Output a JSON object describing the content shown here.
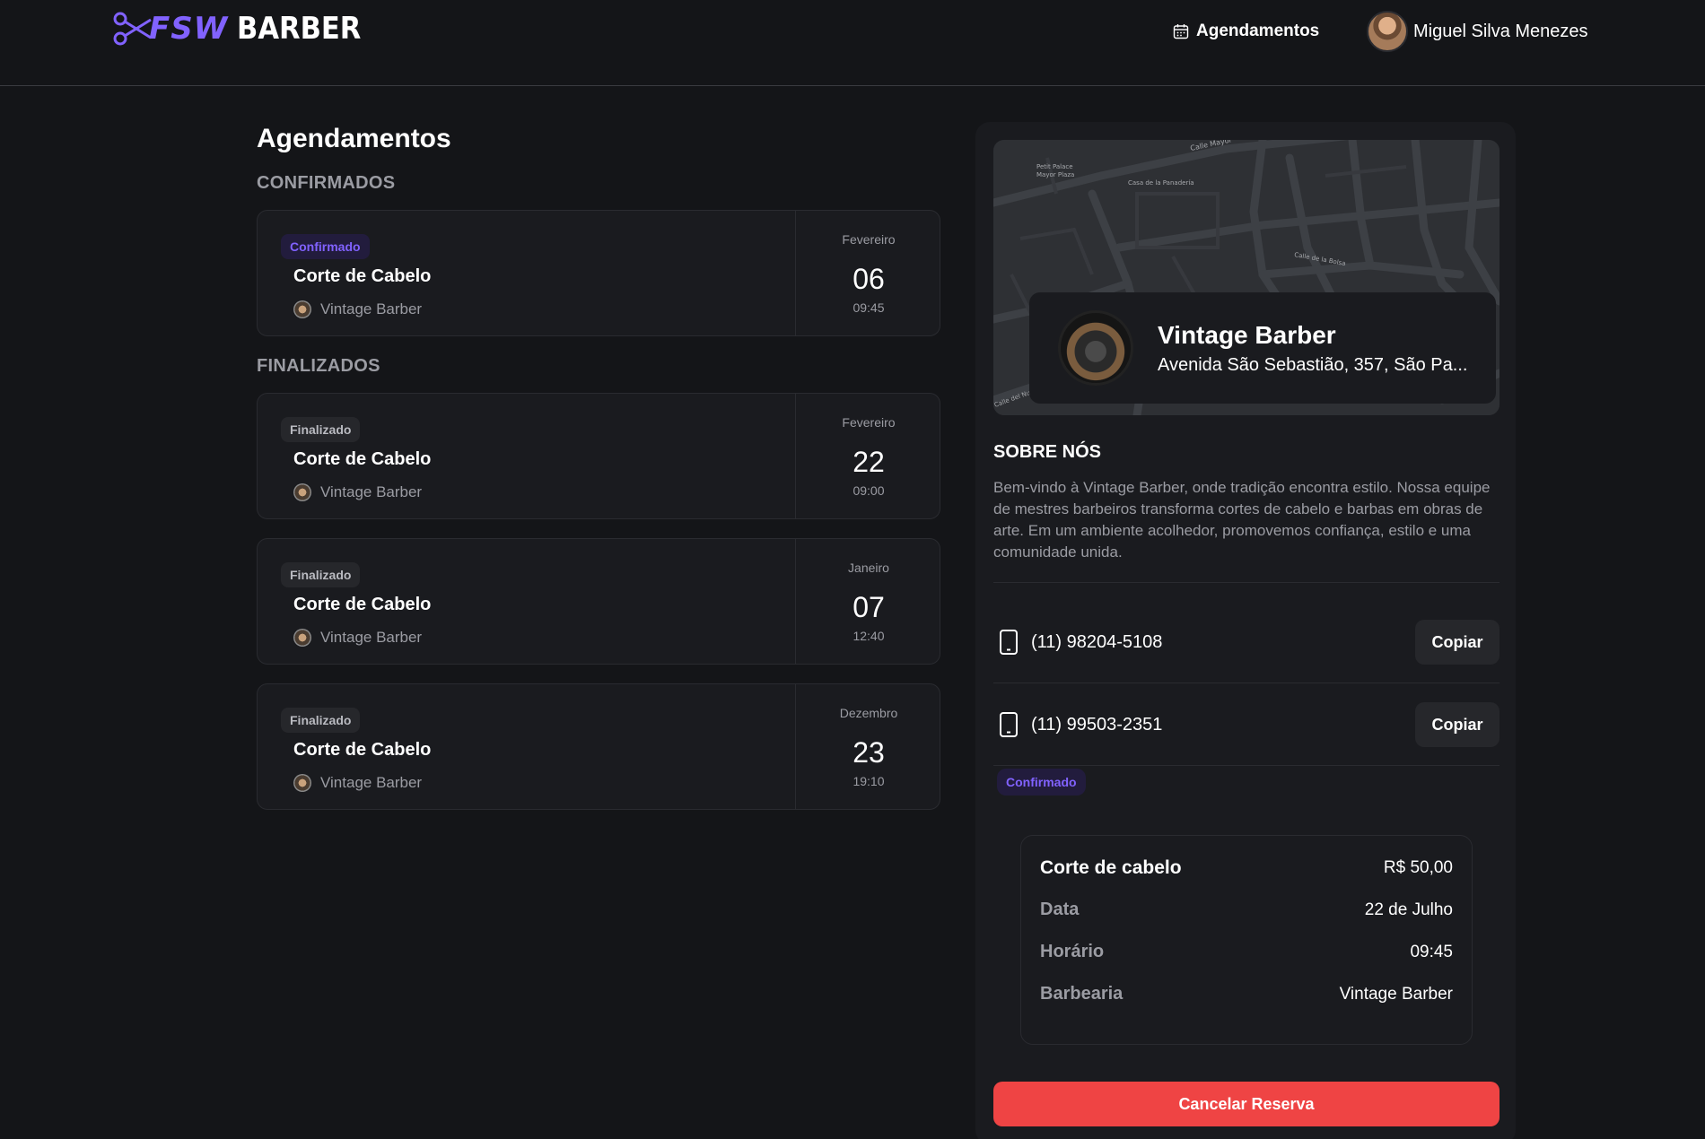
{
  "header": {
    "logo_fsw": "FSW",
    "logo_barber": "BARBER",
    "nav_appointments": "Agendamentos",
    "user_name": "Miguel Silva Menezes"
  },
  "main": {
    "title": "Agendamentos",
    "confirmed_label": "CONFIRMADOS",
    "finished_label": "FINALIZADOS",
    "confirmed": [
      {
        "status": "Confirmado",
        "service": "Corte de Cabelo",
        "shop": "Vintage Barber",
        "month": "Fevereiro",
        "day": "06",
        "time": "09:45"
      }
    ],
    "finished": [
      {
        "status": "Finalizado",
        "service": "Corte de Cabelo",
        "shop": "Vintage Barber",
        "month": "Fevereiro",
        "day": "22",
        "time": "09:00"
      },
      {
        "status": "Finalizado",
        "service": "Corte de Cabelo",
        "shop": "Vintage Barber",
        "month": "Janeiro",
        "day": "07",
        "time": "12:40"
      },
      {
        "status": "Finalizado",
        "service": "Corte de Cabelo",
        "shop": "Vintage Barber",
        "month": "Dezembro",
        "day": "23",
        "time": "19:10"
      }
    ]
  },
  "details": {
    "map_labels": {
      "petit_palace": "Petit Palace",
      "mayor_plaza": "Mayor Plaza",
      "calle_mayor": "Calle Mayor",
      "casa_panaderia": "Casa de la Panadería",
      "calle_bolsa": "Calle de la Bolsa",
      "calle_nuncio": "Calle del Nuncio"
    },
    "shop_name": "Vintage Barber",
    "shop_address": "Avenida São Sebastião, 357, São Pa...",
    "about_title": "SOBRE NÓS",
    "about_text": "Bem-vindo à Vintage Barber, onde tradição encontra estilo. Nossa equipe de mestres barbeiros transforma cortes de cabelo e barbas em obras de arte. Em um ambiente acolhedor, promovemos confiança, estilo e uma comunidade unida.",
    "phones": [
      "(11) 98204-5108",
      "(11) 99503-2351"
    ],
    "copy_label": "Copiar",
    "status": "Confirmado",
    "summary": {
      "service": "Corte de cabelo",
      "price": "R$ 50,00",
      "date_label": "Data",
      "date_value": "22 de Julho",
      "time_label": "Horário",
      "time_value": "09:45",
      "shop_label": "Barbearia",
      "shop_value": "Vintage Barber"
    },
    "cancel_label": "Cancelar Reserva"
  },
  "colors": {
    "background": "#141518",
    "card": "#1a1b1f",
    "accent": "#8162ff",
    "danger": "#ef4444",
    "muted": "#9b9ca3"
  }
}
